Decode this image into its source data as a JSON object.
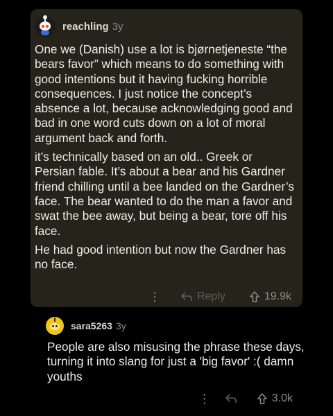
{
  "comments": [
    {
      "username": "reachling",
      "age": "3y",
      "paragraphs": [
        "One we (Danish) use a lot is bjørnetjeneste “the bears favor” which means to do something with good intentions but it having fucking horrible consequences. I just notice the concept’s absence a lot, because acknowledging good and bad in one word cuts down on a lot of moral argument back and forth.",
        "it’s technically based on an old.. Greek or Persian fable. It’s about a bear and his Gardner friend chilling until a bee landed on the Gardner’s face. The bear wanted to do the man a favor and swat the bee away, but being a bear, tore off his face.",
        "He had good intention but now the Gardner has no face."
      ],
      "actions": {
        "more": "⋮",
        "reply_label": "Reply",
        "upvotes": "19.9k"
      }
    },
    {
      "username": "sara5263",
      "age": "3y",
      "text": "People are also misusing the phrase these days, turning it into slang for just a 'big favor' :( damn youths",
      "actions": {
        "more": "⋮",
        "upvotes": "3.0k"
      }
    }
  ],
  "icons": {
    "avatar1": "snoo-avatar-icon",
    "avatar2": "yellow-snoo-avatar-icon",
    "reply": "reply-arrow-icon",
    "upvote": "upvote-arrow-icon",
    "more": "more-vertical-icon"
  },
  "colors": {
    "background": "#000000",
    "highlight_card": "#26241a",
    "text": "#ececec",
    "muted": "#8a8a8a"
  }
}
